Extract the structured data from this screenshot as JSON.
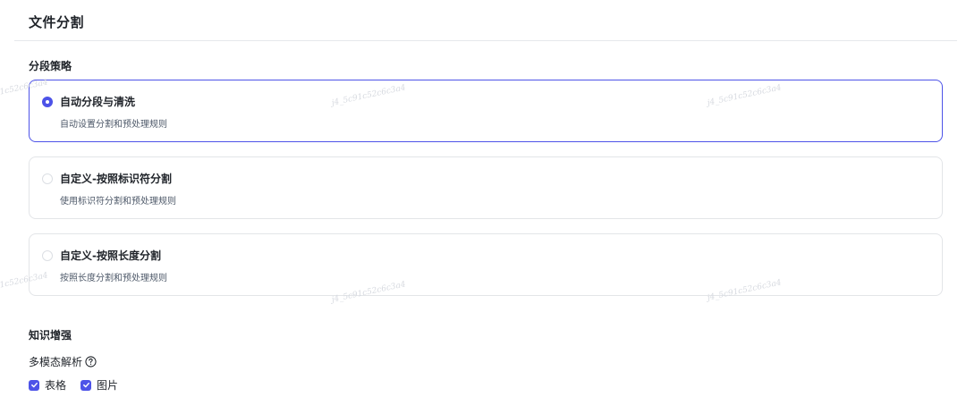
{
  "page": {
    "title": "文件分割"
  },
  "segmentation": {
    "section_title": "分段策略",
    "options": [
      {
        "title": "自动分段与清洗",
        "description": "自动设置分割和预处理规则",
        "selected": true
      },
      {
        "title": "自定义-按照标识符分割",
        "description": "使用标识符分割和预处理规则",
        "selected": false
      },
      {
        "title": "自定义-按照长度分割",
        "description": "按照长度分割和预处理规则",
        "selected": false
      }
    ]
  },
  "knowledge": {
    "section_title": "知识增强",
    "multimodal_label": "多模态解析",
    "help_icon": "question-circle-icon",
    "checkboxes": [
      {
        "label": "表格",
        "checked": true
      },
      {
        "label": "图片",
        "checked": true
      }
    ]
  },
  "watermark": {
    "text": "j4_5c91c52c6c3a4"
  },
  "colors": {
    "accent": "#4d53e8",
    "border": "#e3e5e8",
    "text_primary": "#1f2329",
    "text_secondary": "#4e5969"
  }
}
